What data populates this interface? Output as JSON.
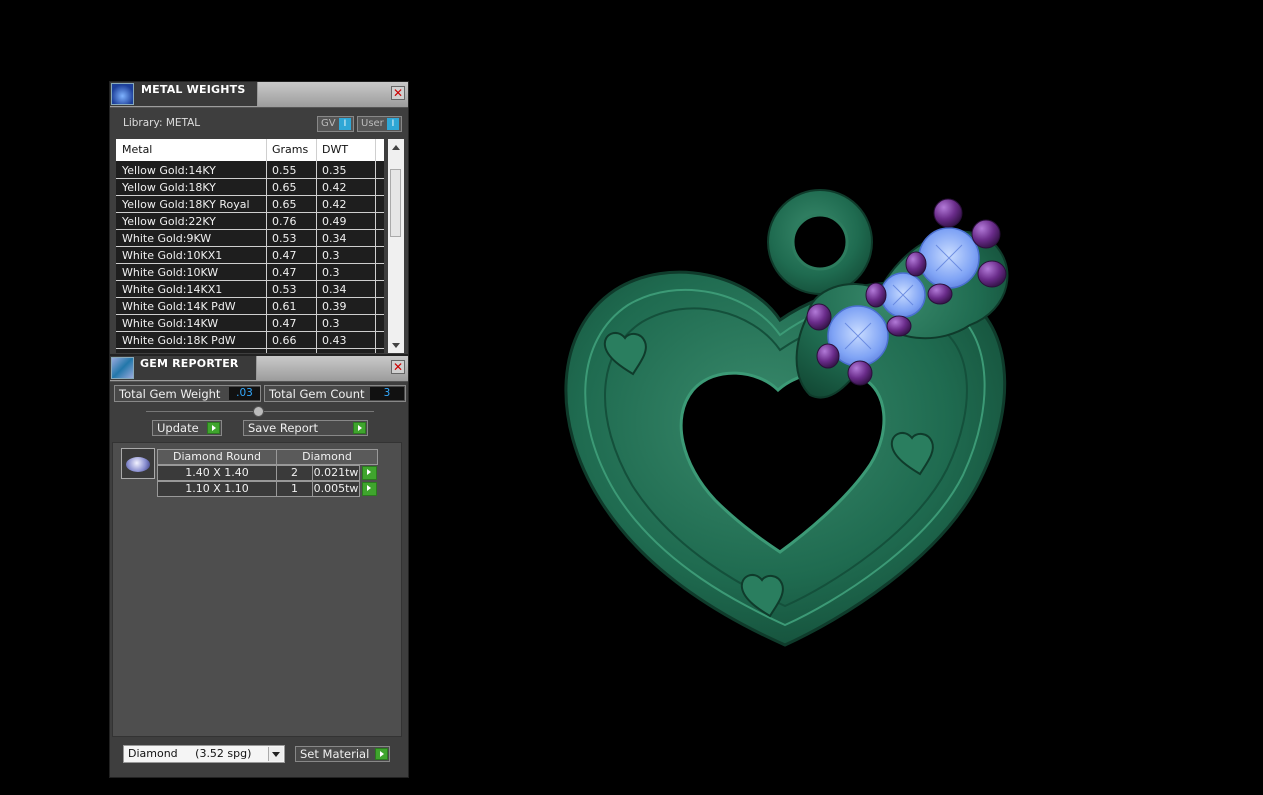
{
  "metal_weights": {
    "title": "METAL WEIGHTS",
    "close_symbol": "✕",
    "library_label": "Library: METAL",
    "toggles": [
      {
        "label": "GV",
        "knob": "I"
      },
      {
        "label": "User",
        "knob": "I"
      }
    ],
    "columns": [
      "Metal",
      "Grams",
      "DWT"
    ],
    "rows": [
      {
        "metal": "Yellow Gold:14KY",
        "grams": "0.55",
        "dwt": "0.35"
      },
      {
        "metal": "Yellow Gold:18KY",
        "grams": "0.65",
        "dwt": "0.42"
      },
      {
        "metal": "Yellow Gold:18KY Royal",
        "grams": "0.65",
        "dwt": "0.42"
      },
      {
        "metal": "Yellow Gold:22KY",
        "grams": "0.76",
        "dwt": "0.49"
      },
      {
        "metal": "White Gold:9KW",
        "grams": "0.53",
        "dwt": "0.34"
      },
      {
        "metal": "White Gold:10KX1",
        "grams": "0.47",
        "dwt": "0.3"
      },
      {
        "metal": "White Gold:10KW",
        "grams": "0.47",
        "dwt": "0.3"
      },
      {
        "metal": "White Gold:14KX1",
        "grams": "0.53",
        "dwt": "0.34"
      },
      {
        "metal": "White Gold:14K PdW",
        "grams": "0.61",
        "dwt": "0.39"
      },
      {
        "metal": "White Gold:14KW",
        "grams": "0.47",
        "dwt": "0.3"
      },
      {
        "metal": "White Gold:18K PdW",
        "grams": "0.66",
        "dwt": "0.43"
      }
    ]
  },
  "gem_reporter": {
    "title": "GEM REPORTER",
    "close_symbol": "✕",
    "total_weight_label": "Total Gem Weight",
    "total_weight_value": ".03",
    "total_count_label": "Total Gem Count",
    "total_count_value": "3",
    "update_label": "Update",
    "save_report_label": "Save Report",
    "table_header": [
      "Diamond Round",
      "Diamond"
    ],
    "gems": [
      {
        "size": "1.40 X 1.40",
        "count": "2",
        "weight": "0.021tw"
      },
      {
        "size": "1.10 X 1.10",
        "count": "1",
        "weight": "0.005tw"
      }
    ],
    "material_select": "Diamond     (3.52 spg)",
    "set_material_label": "Set Material"
  },
  "colors": {
    "metal_model": "#1f6b50",
    "gem": "#8fb4ff",
    "prong": "#6a2c8a",
    "accent_go": "#3fa52d",
    "value_text": "#33aaff"
  }
}
